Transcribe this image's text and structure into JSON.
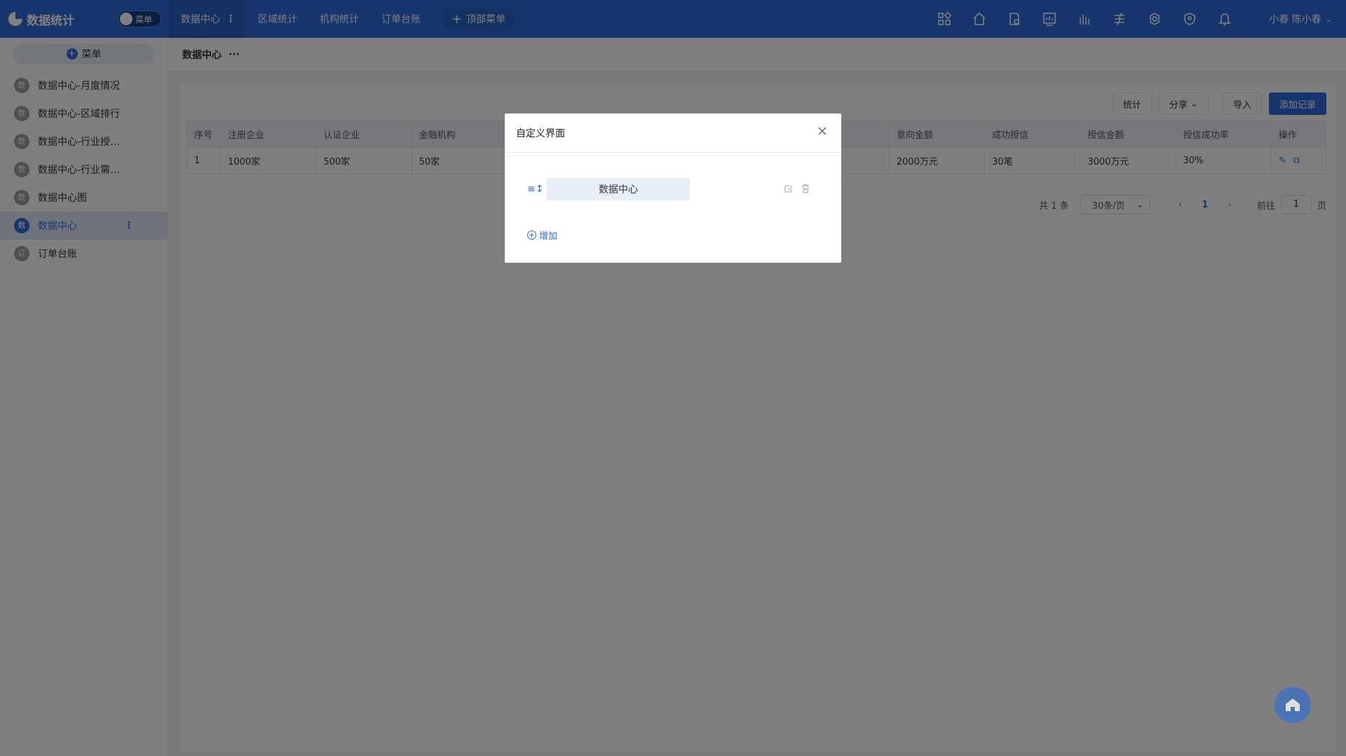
{
  "app": {
    "title": "数据统计",
    "toggle_label": "菜单"
  },
  "topnav": {
    "tabs": [
      {
        "label": "数据中心",
        "active": true
      },
      {
        "label": "区域统计"
      },
      {
        "label": "机构统计"
      },
      {
        "label": "订单台账"
      }
    ],
    "add_menu_label": "顶部菜单",
    "icons": [
      "apps-icon",
      "home-icon",
      "document-icon",
      "dashboard-icon",
      "chart-icon",
      "strategy-icon",
      "settings-icon",
      "shield-icon",
      "bell-icon"
    ],
    "user_short": "小春",
    "user_name": "陈小春"
  },
  "sidebar": {
    "add_label": "菜单",
    "items": [
      {
        "badge": "数",
        "label": "数据中心-月度情况"
      },
      {
        "badge": "数",
        "label": "数据中心-区域排行"
      },
      {
        "badge": "数",
        "label": "数据中心-行业授…"
      },
      {
        "badge": "数",
        "label": "数据中心-行业需…"
      },
      {
        "badge": "数",
        "label": "数据中心图"
      },
      {
        "badge": "数",
        "label": "数据中心",
        "active": true
      },
      {
        "badge": "订",
        "label": "订单台账"
      }
    ]
  },
  "main": {
    "breadcrumb": "数据中心",
    "actions": {
      "stats": "统计",
      "share": "分享",
      "import": "导入",
      "add_record": "添加记录"
    },
    "table": {
      "headers": [
        "序号",
        "注册企业",
        "认证企业",
        "金融机构",
        "",
        "",
        "",
        "",
        "意向金额",
        "成功授信",
        "授信金额",
        "授信成功率",
        "操作"
      ],
      "rows": [
        [
          "1",
          "1000家",
          "500家",
          "50家",
          "",
          "",
          "",
          "",
          "2000万元",
          "30笔",
          "3000万元",
          "30%"
        ]
      ]
    },
    "pager": {
      "total": "共 1 条",
      "page_size": "30条/页",
      "current": "1",
      "goto_label": "前往",
      "goto_value": "1",
      "page_suffix": "页"
    }
  },
  "dialog": {
    "title": "自定义界面",
    "item_value": "数据中心",
    "add_label": "增加"
  },
  "colors": {
    "primary": "#2f6bd8",
    "topbar": "#2f6bd8"
  }
}
